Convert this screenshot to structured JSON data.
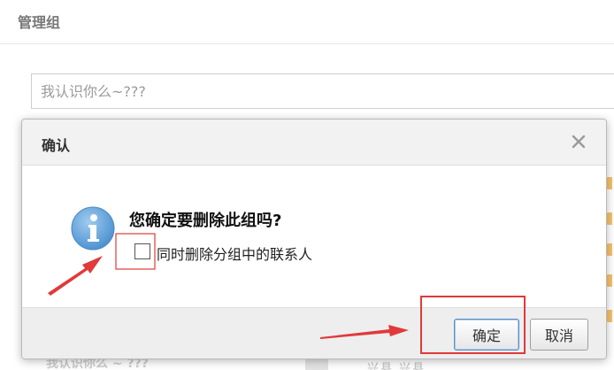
{
  "page": {
    "title": "管理组",
    "group_input_placeholder": "我认识你么~???",
    "bottom_left_text": "我认识你么 ~ ???",
    "bottom_right_text": "兴县  兴县"
  },
  "dialog": {
    "title": "确认",
    "question": "您确定要删除此组吗?",
    "checkbox_label": "同时删除分组中的联系人",
    "checkbox_checked": false,
    "confirm_label": "确定",
    "cancel_label": "取消",
    "icons": {
      "close": "close-icon",
      "info": "info-icon"
    }
  },
  "colors": {
    "annotation": "#e03a3a",
    "info_icon": "#6aa8dc",
    "confirm_border": "#5a8fc6"
  }
}
